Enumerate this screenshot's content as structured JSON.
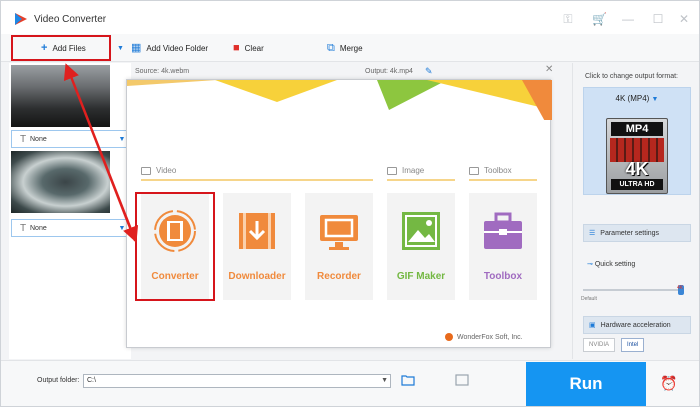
{
  "window": {
    "title": "Video Converter"
  },
  "toolbar": {
    "add_files": "Add Files",
    "add_video_folder": "Add Video Folder",
    "clear": "Clear",
    "merge": "Merge"
  },
  "file_list": {
    "items": [
      {
        "subtitle": "None"
      },
      {
        "subtitle": "None"
      }
    ]
  },
  "info": {
    "source": "Source: 4k.webm",
    "output": "Output: 4k.mp4"
  },
  "popup": {
    "sections": {
      "video": "Video",
      "image": "Image",
      "toolbox": "Toolbox"
    },
    "cards": [
      {
        "label": "Converter",
        "icon": "film-icon"
      },
      {
        "label": "Downloader",
        "icon": "download-icon"
      },
      {
        "label": "Recorder",
        "icon": "screen-record-icon"
      },
      {
        "label": "GIF Maker",
        "icon": "image-icon"
      },
      {
        "label": "Toolbox",
        "icon": "toolbox-icon"
      }
    ],
    "brand": "WonderFox Soft, Inc."
  },
  "right_panel": {
    "caption": "Click to change output format:",
    "format": "4K (MP4)",
    "format_icon_text": {
      "top": "MP4",
      "mid": "4K",
      "bottom": "ULTRA HD"
    },
    "parameter_settings": "Parameter settings",
    "quick_setting": "Quick setting",
    "slider_min_label": "Default",
    "slider_max_label": "4K",
    "hardware_acceleration": "Hardware acceleration",
    "accel_chips": [
      "NVIDIA",
      "Intel"
    ]
  },
  "bottom": {
    "output_folder_label": "Output folder:",
    "output_folder_value": "C:\\",
    "run": "Run"
  },
  "colors": {
    "accent": "#1595f2",
    "highlight": "#d6151b",
    "orange_icon": "#f08a3c",
    "green_icon": "#74b843",
    "purple_icon": "#a06bc0",
    "deco_yellow": "#f7d13a"
  }
}
